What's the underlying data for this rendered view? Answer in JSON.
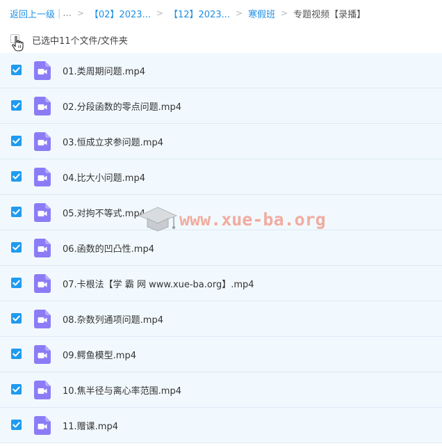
{
  "breadcrumb": {
    "back_label": "返回上一级",
    "separator_bar": "|",
    "ellipsis": "...",
    "arrow": ">",
    "items": [
      {
        "label": "【02】2023..."
      },
      {
        "label": "【12】2023..."
      },
      {
        "label": "寒假班"
      }
    ],
    "current": "专题视频【录播】"
  },
  "selection": {
    "text": "已选中11个文件/文件夹"
  },
  "files": [
    {
      "name": "01.类周期问题.mp4",
      "checked": true
    },
    {
      "name": "02.分段函数的零点问题.mp4",
      "checked": true
    },
    {
      "name": "03.恒成立求参问题.mp4",
      "checked": true
    },
    {
      "name": "04.比大小问题.mp4",
      "checked": true
    },
    {
      "name": "05.对拘不等式.mp4",
      "checked": true
    },
    {
      "name": "06.函数的凹凸性.mp4",
      "checked": true
    },
    {
      "name": "07.卡根法【学 霸 网 www.xue-ba.org】.mp4",
      "checked": true
    },
    {
      "name": "08.杂数列通项问题.mp4",
      "checked": true
    },
    {
      "name": "09.鳄鱼模型.mp4",
      "checked": true
    },
    {
      "name": "10.焦半径与离心率范围.mp4",
      "checked": true
    },
    {
      "name": "11.赠课.mp4",
      "checked": true
    }
  ],
  "watermark": {
    "text": "www.xue-ba.org"
  },
  "colors": {
    "accent": "#1e8fe6",
    "checkbox": "#1f9bf0",
    "video_icon": "#8b7cf6",
    "row_bg": "#f2f9fe",
    "watermark": "#f06e50"
  },
  "icons": {
    "file": "video-file-icon",
    "checkbox": "checkmark-icon",
    "cursor": "hand-pointer-icon",
    "watermark_logo": "graduation-cap-icon"
  }
}
